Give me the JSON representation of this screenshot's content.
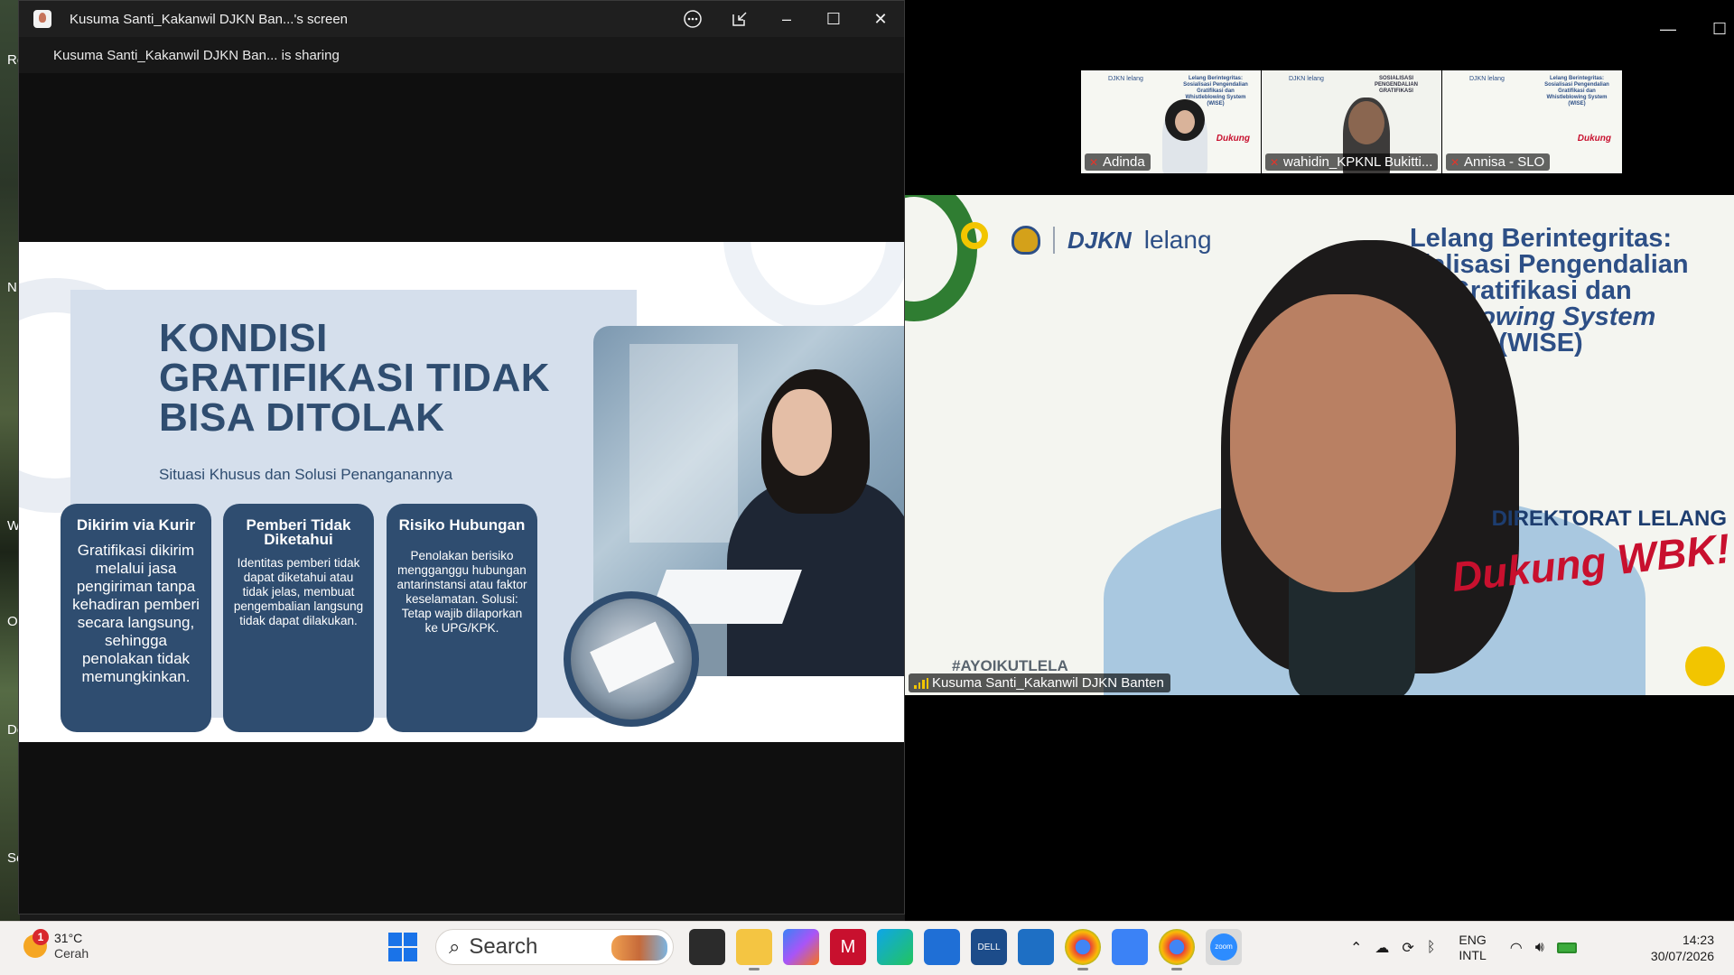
{
  "desktop": {
    "labels": [
      "Re",
      "N",
      "W",
      "O",
      "Do",
      "Se"
    ]
  },
  "share_window": {
    "title": "Kusuma Santi_Kakanwil DJKN Ban...'s screen",
    "sharing_status": "Kusuma Santi_Kakanwil DJKN Ban... is sharing",
    "more_icon": "more-icon",
    "popout_icon": "popout-icon",
    "minimize": "–",
    "maximize": "☐",
    "close": "✕"
  },
  "slide": {
    "heading": [
      "KONDISI",
      "GRATIFIKASI TIDAK",
      "BISA DITOLAK"
    ],
    "subheading": "Situasi Khusus dan Solusi Penanganannya",
    "cards": [
      {
        "title": "Dikirim via Kurir",
        "body": "Gratifikasi dikirim melalui jasa pengiriman tanpa kehadiran pemberi secara langsung, sehingga penolakan tidak memungkinkan."
      },
      {
        "title": "Pemberi Tidak Diketahui",
        "body": "Identitas pemberi tidak dapat diketahui atau tidak jelas, membuat pengembalian langsung tidak dapat dilakukan."
      },
      {
        "title": "Risiko Hubungan",
        "body": "Penolakan berisiko mengganggu hubungan antarinstansi atau faktor keselamatan. Solusi: Tetap wajib dilaporkan ke UPG/KPK."
      }
    ]
  },
  "zoom": {
    "minimize": "—",
    "restore": "☐",
    "thumbnails": [
      {
        "name": "Adinda",
        "title": "Lelang Berintegritas: Sosialisasi Pengendalian Gratifikasi dan Whistleblowing System (WISE)",
        "brand": "DJKN lelang"
      },
      {
        "name": "wahidin_KPKNL Bukitti...",
        "title": "SOSIALISASI PENGENDALIAN GRATIFIKASI",
        "brand": "DJKN lelang"
      },
      {
        "name": "Annisa - SLO",
        "title": "Lelang Berintegritas: Sosialisasi Pengendalian Gratifikasi dan Whistleblowing System (WISE)",
        "brand": "DJKN lelang"
      }
    ],
    "speaker": {
      "name": "Kusuma Santi_Kakanwil DJKN Banten",
      "brand_djkn": "DJKN",
      "brand_lelang": "lelang",
      "headline": [
        "Lelang Berintegritas:",
        "osialisasi Pengendalian",
        "Gratifikasi dan",
        "tleblowing System",
        "(WISE)"
      ],
      "direktorat": "DIREKTORAT LELANG",
      "dukung": "Dukung WBK!",
      "hashtag": "#AYOIKUTLELA"
    }
  },
  "taskbar": {
    "weather_temp": "31°C",
    "weather_cond": "Cerah",
    "weather_badge": "1",
    "search_placeholder": "Search",
    "lang_top": "ENG",
    "lang_bottom": "INTL",
    "time": "14:23",
    "date": "30/07/2026"
  }
}
